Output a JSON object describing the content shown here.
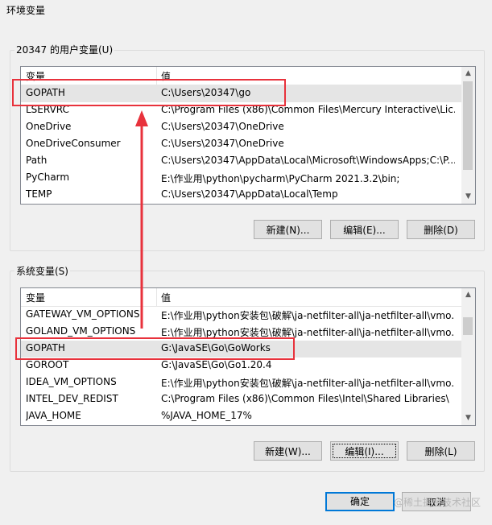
{
  "window": {
    "title": "环境变量"
  },
  "user_vars": {
    "label": "20347 的用户变量(U)",
    "headers": [
      "变量",
      "值"
    ],
    "rows": [
      [
        "GOPATH",
        "C:\\Users\\20347\\go"
      ],
      [
        "LSERVRC",
        "C:\\Program Files (x86)\\Common Files\\Mercury Interactive\\Lic..."
      ],
      [
        "OneDrive",
        "C:\\Users\\20347\\OneDrive"
      ],
      [
        "OneDriveConsumer",
        "C:\\Users\\20347\\OneDrive"
      ],
      [
        "Path",
        "C:\\Users\\20347\\AppData\\Local\\Microsoft\\WindowsApps;C:\\P..."
      ],
      [
        "PyCharm",
        "E:\\作业用\\python\\pycharm\\PyCharm 2021.3.2\\bin;"
      ],
      [
        "TEMP",
        "C:\\Users\\20347\\AppData\\Local\\Temp"
      ]
    ],
    "buttons": {
      "new": "新建(N)...",
      "edit": "编辑(E)...",
      "delete": "删除(D)"
    }
  },
  "system_vars": {
    "label": "系统变量(S)",
    "headers": [
      "变量",
      "值"
    ],
    "rows": [
      [
        "GATEWAY_VM_OPTIONS",
        "E:\\作业用\\python安装包\\破解\\ja-netfilter-all\\ja-netfilter-all\\vmo..."
      ],
      [
        "GOLAND_VM_OPTIONS",
        "E:\\作业用\\python安装包\\破解\\ja-netfilter-all\\ja-netfilter-all\\vmo..."
      ],
      [
        "GOPATH",
        "G:\\JavaSE\\Go\\GoWorks"
      ],
      [
        "GOROOT",
        "G:\\JavaSE\\Go\\Go1.20.4"
      ],
      [
        "IDEA_VM_OPTIONS",
        "E:\\作业用\\python安装包\\破解\\ja-netfilter-all\\ja-netfilter-all\\vmo..."
      ],
      [
        "INTEL_DEV_REDIST",
        "C:\\Program Files (x86)\\Common Files\\Intel\\Shared Libraries\\"
      ],
      [
        "JAVA_HOME",
        "%JAVA_HOME_17%"
      ]
    ],
    "buttons": {
      "new": "新建(W)...",
      "edit": "编辑(I)...",
      "delete": "删除(L)"
    }
  },
  "footer": {
    "ok": "确定",
    "cancel": "取消"
  },
  "watermark": "@稀土掘金技术社区",
  "colors": {
    "highlight": "#e8323c",
    "focus": "#0078d7"
  }
}
